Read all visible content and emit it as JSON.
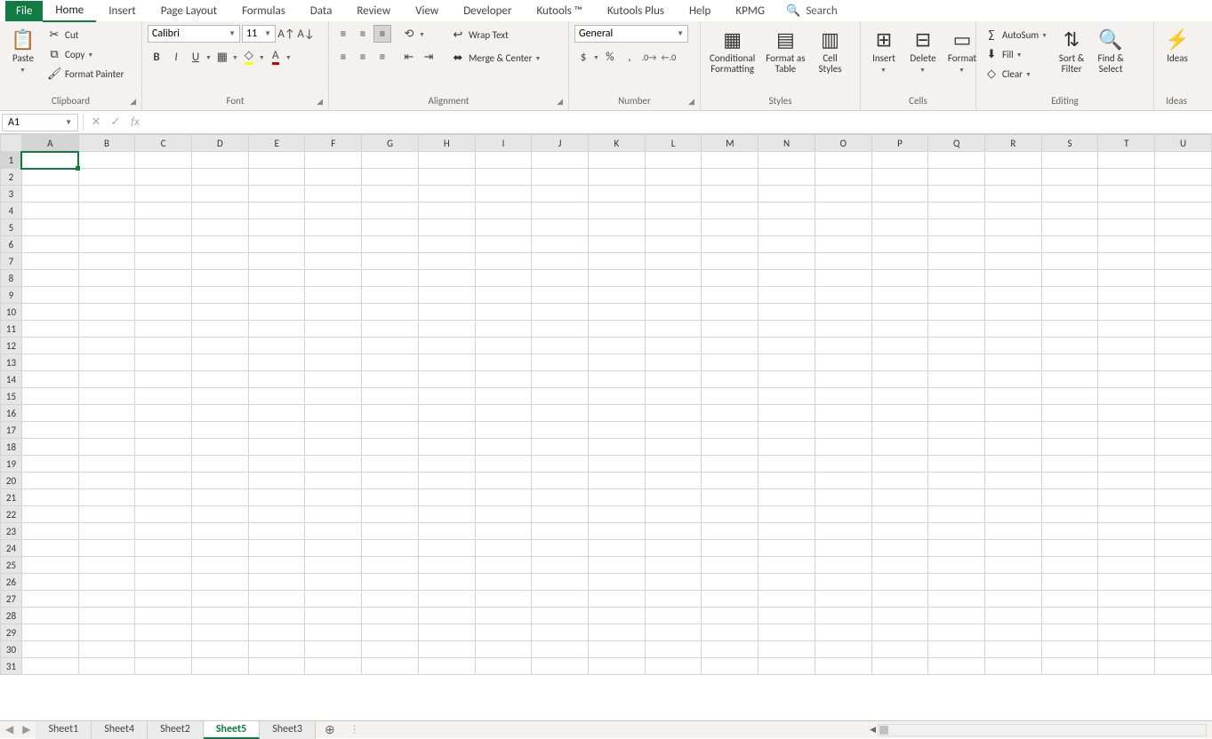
{
  "tabs": {
    "file": "File",
    "items": [
      "Home",
      "Insert",
      "Page Layout",
      "Formulas",
      "Data",
      "Review",
      "View",
      "Developer",
      "Kutools ™",
      "Kutools Plus",
      "Help",
      "KPMG"
    ],
    "active": "Home",
    "search": "Search"
  },
  "ribbon": {
    "clipboard": {
      "label": "Clipboard",
      "paste": "Paste",
      "cut": "Cut",
      "copy": "Copy",
      "format_painter": "Format Painter"
    },
    "font": {
      "label": "Font",
      "name": "Calibri",
      "size": "11"
    },
    "alignment": {
      "label": "Alignment",
      "wrap": "Wrap Text",
      "merge": "Merge & Center"
    },
    "number": {
      "label": "Number",
      "format": "General"
    },
    "styles": {
      "label": "Styles",
      "cond": "Conditional\nFormatting",
      "table": "Format as\nTable",
      "cell": "Cell\nStyles"
    },
    "cells": {
      "label": "Cells",
      "insert": "Insert",
      "delete": "Delete",
      "format": "Format"
    },
    "editing": {
      "label": "Editing",
      "autosum": "AutoSum",
      "fill": "Fill",
      "clear": "Clear",
      "sort": "Sort &\nFilter",
      "find": "Find &\nSelect"
    },
    "ideas": {
      "label": "Ideas",
      "ideas": "Ideas"
    }
  },
  "formula_bar": {
    "name_box": "A1",
    "formula": ""
  },
  "grid": {
    "columns": [
      "A",
      "B",
      "C",
      "D",
      "E",
      "F",
      "G",
      "H",
      "I",
      "J",
      "K",
      "L",
      "M",
      "N",
      "O",
      "P",
      "Q",
      "R",
      "S",
      "T",
      "U"
    ],
    "rows": 31,
    "selected_cell": "A1"
  },
  "sheets": {
    "items": [
      "Sheet1",
      "Sheet4",
      "Sheet2",
      "Sheet5",
      "Sheet3"
    ],
    "active": "Sheet5"
  }
}
